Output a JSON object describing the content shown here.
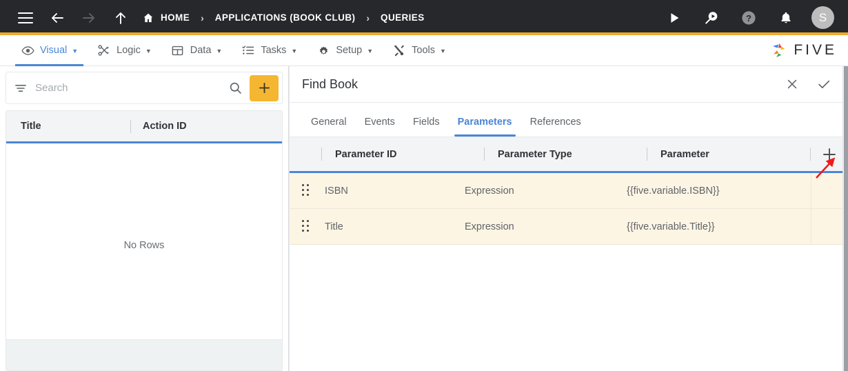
{
  "topbar": {
    "menu_icon": "hamburger-icon",
    "back_icon": "arrow-left-icon",
    "forward_icon": "arrow-right-icon",
    "up_icon": "arrow-up-icon",
    "breadcrumbs": [
      {
        "label": "HOME",
        "icon": "home-icon"
      },
      {
        "label": "APPLICATIONS (BOOK CLUB)",
        "icon": ""
      },
      {
        "label": "QUERIES",
        "icon": ""
      }
    ],
    "separator": "›",
    "right_icons": [
      {
        "name": "run-icon",
        "glyph": "play"
      },
      {
        "name": "search-run-icon",
        "glyph": "magnifier-play"
      },
      {
        "name": "help-icon",
        "glyph": "question"
      },
      {
        "name": "notifications-icon",
        "glyph": "bell"
      }
    ],
    "avatar_initial": "S",
    "accent_color": "#f0ab2b",
    "background_color": "#26282b"
  },
  "menubar": {
    "items": [
      {
        "label": "Visual",
        "icon": "eye-icon",
        "caret": "▼",
        "active": true
      },
      {
        "label": "Logic",
        "icon": "logic-nodes-icon",
        "caret": "▼",
        "active": false
      },
      {
        "label": "Data",
        "icon": "table-icon",
        "caret": "▼",
        "active": false
      },
      {
        "label": "Tasks",
        "icon": "tasks-list-icon",
        "caret": "▼",
        "active": false
      },
      {
        "label": "Setup",
        "icon": "gear-icon",
        "caret": "▼",
        "active": false
      },
      {
        "label": "Tools",
        "icon": "tools-icon",
        "caret": "▼",
        "active": false
      }
    ],
    "brand": "FIVE",
    "active_color": "#4a86d6"
  },
  "left_panel": {
    "search": {
      "placeholder": "Search",
      "value": "",
      "filter_icon": "filter-icon",
      "search_icon": "search-icon"
    },
    "add_button_label": "+",
    "add_button_color": "#f5b731",
    "grid": {
      "columns": [
        "Title",
        "Action ID"
      ],
      "rows": [],
      "empty_message": "No Rows"
    }
  },
  "right_panel": {
    "title": "Find Book",
    "header_actions": [
      {
        "name": "close-icon",
        "label": "✕"
      },
      {
        "name": "confirm-check-icon",
        "label": "✓"
      }
    ],
    "tabs": [
      {
        "label": "General",
        "active": false
      },
      {
        "label": "Events",
        "active": false
      },
      {
        "label": "Fields",
        "active": false
      },
      {
        "label": "Parameters",
        "active": true
      },
      {
        "label": "References",
        "active": false
      }
    ],
    "grid": {
      "columns": [
        "Parameter ID",
        "Parameter Type",
        "Parameter"
      ],
      "add_row_label": "+",
      "rows": [
        {
          "parameter_id": "ISBN",
          "parameter_type": "Expression",
          "parameter": "{{five.variable.ISBN}}"
        },
        {
          "parameter_id": "Title",
          "parameter_type": "Expression",
          "parameter": "{{five.variable.Title}}"
        }
      ],
      "row_background": "#fdf5e4",
      "header_underline": "#4a86d6"
    }
  },
  "annotation": {
    "arrow": "red-arrow-pointing-to-add-parameter-button",
    "color": "#ee1b1b"
  }
}
